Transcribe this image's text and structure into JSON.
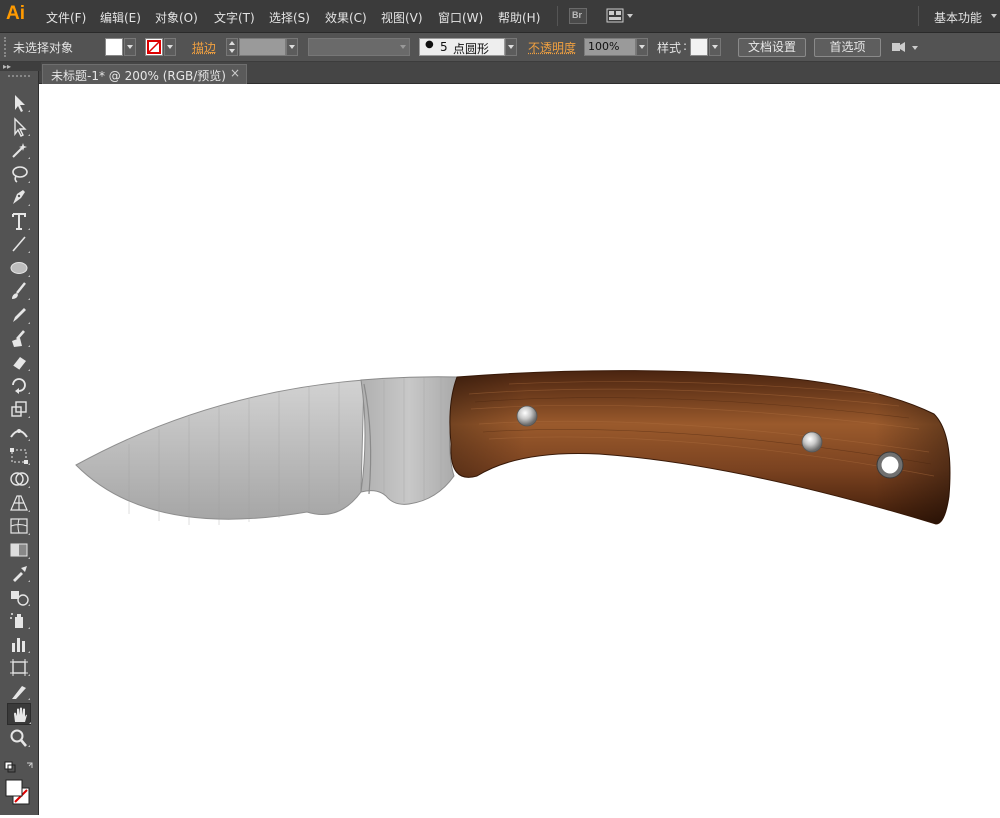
{
  "app": {
    "logo": "Ai",
    "workspace": "基本功能"
  },
  "menu": [
    "文件(F)",
    "编辑(E)",
    "对象(O)",
    "文字(T)",
    "选择(S)",
    "效果(C)",
    "视图(V)",
    "窗口(W)",
    "帮助(H)"
  ],
  "menubar_icons": [
    "bridge-icon",
    "arrange-documents-icon"
  ],
  "bridge_label": "Br",
  "control": {
    "selection_status": "未选择对象",
    "stroke_label": "描边",
    "brush_size": "5",
    "brush_label": "点圆形",
    "opacity_label": "不透明度",
    "opacity_value": "100%",
    "style_label": "样式",
    "doc_setup_button": "文档设置",
    "preferences_button": "首选项"
  },
  "document_tab": {
    "title": "未标题-1* @ 200% (RGB/预览)",
    "close": "×"
  },
  "tools": [
    "selection-tool-icon",
    "direct-selection-tool-icon",
    "magic-wand-tool-icon",
    "lasso-tool-icon",
    "pen-tool-icon",
    "type-tool-icon",
    "line-segment-tool-icon",
    "ellipse-tool-icon",
    "paintbrush-tool-icon",
    "pencil-tool-icon",
    "blob-brush-tool-icon",
    "eraser-tool-icon",
    "rotate-tool-icon",
    "scale-tool-icon",
    "width-tool-icon",
    "free-transform-tool-icon",
    "shape-builder-tool-icon",
    "perspective-grid-tool-icon",
    "mesh-tool-icon",
    "gradient-tool-icon",
    "eyedropper-tool-icon",
    "blend-tool-icon",
    "symbol-sprayer-tool-icon",
    "column-graph-tool-icon",
    "artboard-tool-icon",
    "slice-tool-icon",
    "hand-tool-icon",
    "zoom-tool-icon"
  ],
  "selected_tool": "hand-tool-icon",
  "colors": {
    "menubar": "#3b3b3b",
    "control_bar": "#535353",
    "accent": "#ff9a00",
    "handle_wood": "#6e3a1a",
    "blade": "#b9b9b9"
  }
}
